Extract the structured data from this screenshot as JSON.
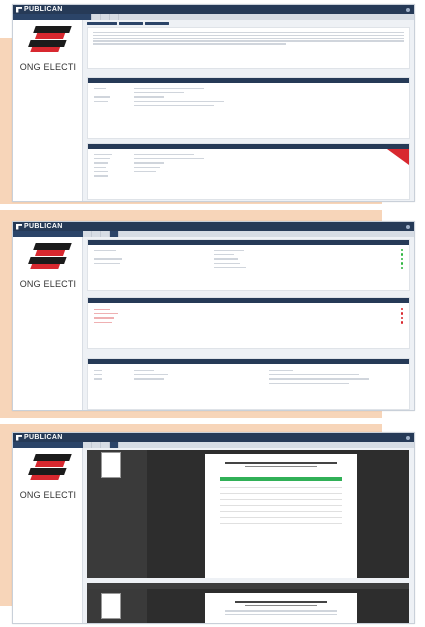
{
  "app": {
    "brand": "PUBLICAN"
  },
  "nav": [
    "",
    "",
    "",
    "",
    ""
  ],
  "tabs": [
    "",
    "",
    "",
    ""
  ],
  "org": {
    "name": "ONG ELECTI",
    "subtitle_line1": "",
    "subtitle_line2": ""
  },
  "colors": {
    "header": "#263a57",
    "accent_red": "#d8282f",
    "ok_green": "#2eb53f",
    "table_green": "#31b057",
    "backdrop": "#f7d5b9"
  },
  "icons": [
    "bell-icon",
    "logo-icon",
    "status-dot-icon",
    "document-thumbnail-icon",
    "corner-badge-icon"
  ]
}
